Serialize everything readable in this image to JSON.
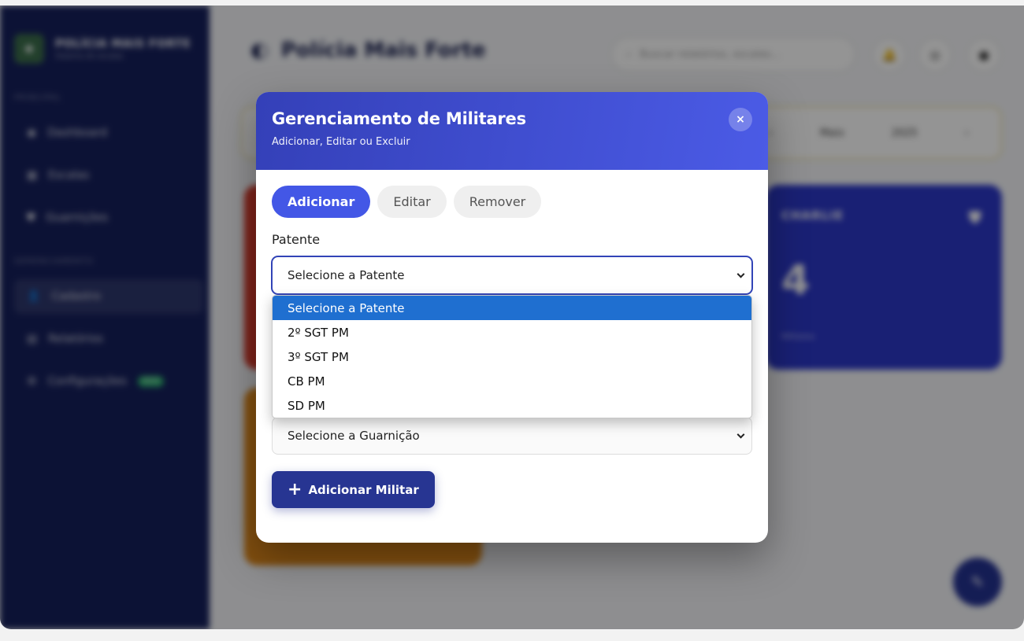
{
  "sidebar": {
    "brand_title": "POLÍCIA MAIS FORTE",
    "brand_subtitle": "Sistema de escalas",
    "section_main": "PRINCIPAL",
    "section_manage": "GERENCIAMENTO",
    "items": [
      {
        "label": "Dashboard",
        "icon": "dashboard-icon"
      },
      {
        "label": "Escalas",
        "icon": "calendar-icon"
      },
      {
        "label": "Guarnições",
        "icon": "shield-icon"
      },
      {
        "label": "Cadastro",
        "icon": "user-add-icon"
      },
      {
        "label": "Relatórios",
        "icon": "report-icon"
      },
      {
        "label": "Configurações",
        "icon": "gear-icon",
        "badge": "NEW"
      }
    ]
  },
  "topbar": {
    "title": "Polícia Mais Forte",
    "search_placeholder": "Buscar relatórios, escalas..."
  },
  "month_bar": {
    "month": "Maio",
    "year": "2025"
  },
  "cards": {
    "blue": {
      "label": "CHARLIE",
      "value": "4",
      "sub": "Militares"
    }
  },
  "modal": {
    "title": "Gerenciamento de Militares",
    "subtitle": "Adicionar, Editar ou Excluir",
    "close_label": "×",
    "tabs": [
      {
        "label": "Adicionar",
        "active": true
      },
      {
        "label": "Editar",
        "active": false
      },
      {
        "label": "Remover",
        "active": false
      }
    ],
    "patente_label": "Patente",
    "patente_value": "Selecione a Patente",
    "guarnicao_value": "Selecione a Guarnição",
    "add_button_label": "Adicionar Militar"
  },
  "dropdown": {
    "options": [
      {
        "label": "Selecione a Patente",
        "selected": true
      },
      {
        "label": "2º SGT PM",
        "selected": false
      },
      {
        "label": "3º SGT PM",
        "selected": false
      },
      {
        "label": "CB PM",
        "selected": false
      },
      {
        "label": "SD PM",
        "selected": false
      }
    ]
  },
  "colors": {
    "sidebar": "#16205c",
    "modal_header_start": "#3440b8",
    "modal_header_end": "#4b5be6",
    "active_tab": "#4357e6",
    "add_button": "#273592",
    "option_selected": "#1f6fd0"
  }
}
